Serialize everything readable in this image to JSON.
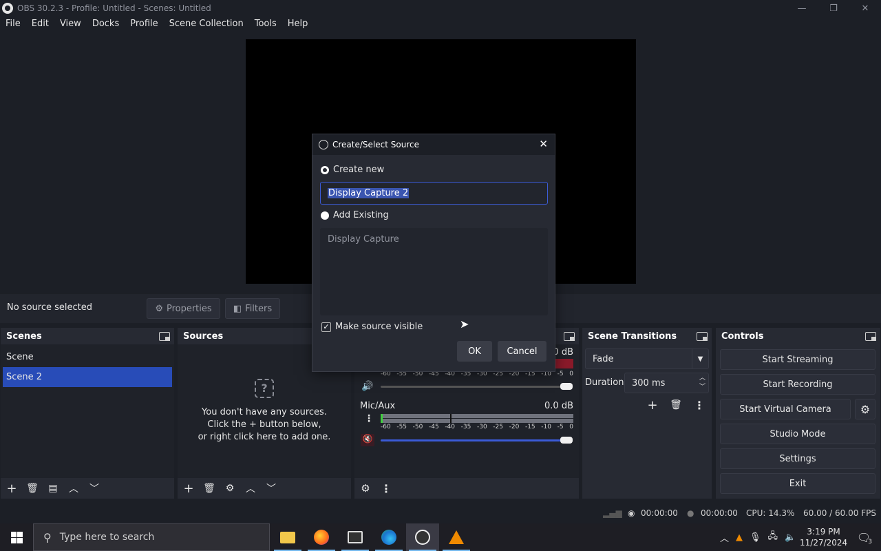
{
  "window": {
    "title": "OBS 30.2.3 - Profile: Untitled - Scenes: Untitled",
    "controls": [
      "—",
      "❐",
      "✕"
    ]
  },
  "menu": [
    "File",
    "Edit",
    "View",
    "Docks",
    "Profile",
    "Scene Collection",
    "Tools",
    "Help"
  ],
  "source_toolbar": {
    "status": "No source selected",
    "properties_label": "Properties",
    "filters_label": "Filters"
  },
  "scenes_dock": {
    "title": "Scenes",
    "items": [
      "Scene",
      "Scene 2"
    ],
    "selected_index": 1
  },
  "sources_dock": {
    "title": "Sources",
    "empty_line1": "You don't have any sources.",
    "empty_line2": "Click the + button below,",
    "empty_line3": "or right click here to add one."
  },
  "mixer": {
    "desktop_db": "0.0 dB",
    "mic_label": "Mic/Aux",
    "mic_db": "0.0 dB",
    "ticks": [
      "-60",
      "-55",
      "-50",
      "-45",
      "-40",
      "-35",
      "-30",
      "-25",
      "-20",
      "-15",
      "-10",
      "-5",
      "0"
    ]
  },
  "transitions": {
    "title": "Scene Transitions",
    "selected": "Fade",
    "duration_label": "Duration",
    "duration_value": "300 ms"
  },
  "controls": {
    "title": "Controls",
    "start_streaming": "Start Streaming",
    "start_recording": "Start Recording",
    "start_virtual_camera": "Start Virtual Camera",
    "studio_mode": "Studio Mode",
    "settings": "Settings",
    "exit": "Exit"
  },
  "statusbar": {
    "stream_time": "00:00:00",
    "record_time": "00:00:00",
    "cpu": "CPU: 14.3%",
    "fps": "60.00 / 60.00 FPS"
  },
  "dialog": {
    "title": "Create/Select Source",
    "create_new_label": "Create new",
    "name_value": "Display Capture 2",
    "add_existing_label": "Add Existing",
    "existing_items": [
      "Display Capture"
    ],
    "make_visible_label": "Make source visible",
    "ok_label": "OK",
    "cancel_label": "Cancel"
  },
  "taskbar": {
    "search_placeholder": "Type here to search",
    "time": "3:19 PM",
    "date": "11/27/2024",
    "notification_count": "3"
  },
  "colors": {
    "accent": "#284cb8",
    "background": "#1c1f26",
    "dock": "#272a33"
  }
}
